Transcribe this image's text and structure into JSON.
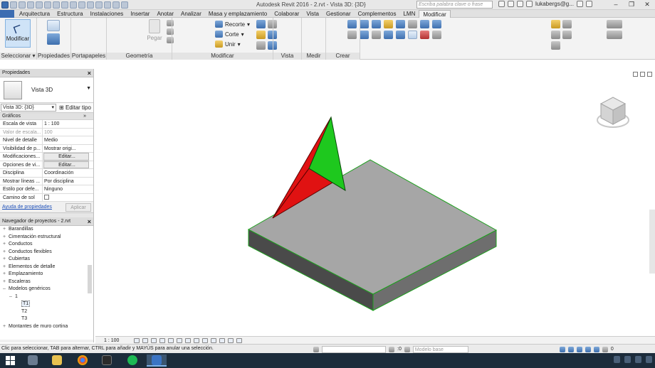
{
  "window": {
    "title": "Autodesk Revit 2016 -     2.rvt - Vista 3D: {3D}",
    "search_placeholder": "Escriba palabra clave o frase",
    "user": "lukabergs@g...",
    "controls": [
      "–",
      "❐",
      "✕"
    ]
  },
  "tabs": [
    "Arquitectura",
    "Estructura",
    "Instalaciones",
    "Insertar",
    "Anotar",
    "Analizar",
    "Masa y emplazamiento",
    "Colaborar",
    "Vista",
    "Gestionar",
    "Complementos",
    "LMN",
    "Modificar"
  ],
  "active_tab": "Modificar",
  "ribbon": {
    "modify_button": "Modificar",
    "paste_label": "Pegar",
    "geometry": {
      "recorte": "Recorte",
      "corte": "Corte",
      "unir": "Unir"
    },
    "panels": {
      "seleccionar": "Seleccionar ▾",
      "propiedades": "Propiedades",
      "portapapeles": "Portapapeles",
      "geometria": "Geometría",
      "modificar": "Modificar",
      "vista": "Vista",
      "medir": "Medir",
      "crear": "Crear"
    }
  },
  "properties": {
    "header": "Propiedades",
    "type_name": "Vista 3D",
    "type_selector": "Vista 3D: {3D}",
    "edit_type": "Editar tipo",
    "section": "Gráficos",
    "rows": [
      {
        "key": "Escala de vista",
        "value": "1 : 100"
      },
      {
        "key": "Valor de escala...",
        "value": "100"
      },
      {
        "key": "Nivel de detalle",
        "value": "Medio"
      },
      {
        "key": "Visibilidad de p...",
        "value": "Mostrar origi..."
      },
      {
        "key": "Modificaciones...",
        "value": "Editar..."
      },
      {
        "key": "Opciones de vi...",
        "value": "Editar..."
      },
      {
        "key": "Disciplina",
        "value": "Coordinación"
      },
      {
        "key": "Mostrar líneas ...",
        "value": "Por disciplina"
      },
      {
        "key": "Estilo por defe...",
        "value": "Ninguno"
      },
      {
        "key": "Camino de sol",
        "value": ""
      }
    ],
    "help_link": "Ayuda de propiedades",
    "apply": "Aplicar"
  },
  "project_browser": {
    "header": "Navegador de proyectos - 2.rvt",
    "items": [
      {
        "label": "Barandillas",
        "level": 1,
        "sign": "+"
      },
      {
        "label": "Cimentación estructural",
        "level": 1,
        "sign": "+"
      },
      {
        "label": "Conductos",
        "level": 1,
        "sign": "+"
      },
      {
        "label": "Conductos flexibles",
        "level": 1,
        "sign": "+"
      },
      {
        "label": "Cubiertas",
        "level": 1,
        "sign": "+"
      },
      {
        "label": "Elementos de detalle",
        "level": 1,
        "sign": "+"
      },
      {
        "label": "Emplazamiento",
        "level": 1,
        "sign": "+"
      },
      {
        "label": "Escaleras",
        "level": 1,
        "sign": "+"
      },
      {
        "label": "Modelos genéricos",
        "level": 1,
        "sign": "–"
      },
      {
        "label": "1",
        "level": 2,
        "sign": "–"
      },
      {
        "label": "T1",
        "level": 3,
        "sign": ""
      },
      {
        "label": "T2",
        "level": 3,
        "sign": ""
      },
      {
        "label": "T3",
        "level": 3,
        "sign": ""
      },
      {
        "label": "Montantes de muro cortina",
        "level": 1,
        "sign": "+"
      }
    ]
  },
  "view": {
    "scale": "1 : 100",
    "colors": {
      "slab_top": "#a6a6a6",
      "slab_side_front": "#4a4a4a",
      "slab_side_right": "#6e6e6e",
      "edge": "#1ea01e",
      "tri_red": "#e01212",
      "tri_green": "#1ec81e"
    }
  },
  "status": {
    "message": "Clic para seleccionar, TAB para alternar, CTRL para añadir y MAYÚS para anular una selección.",
    "zero": ":0",
    "model": "Modelo base",
    "filter": "0"
  }
}
